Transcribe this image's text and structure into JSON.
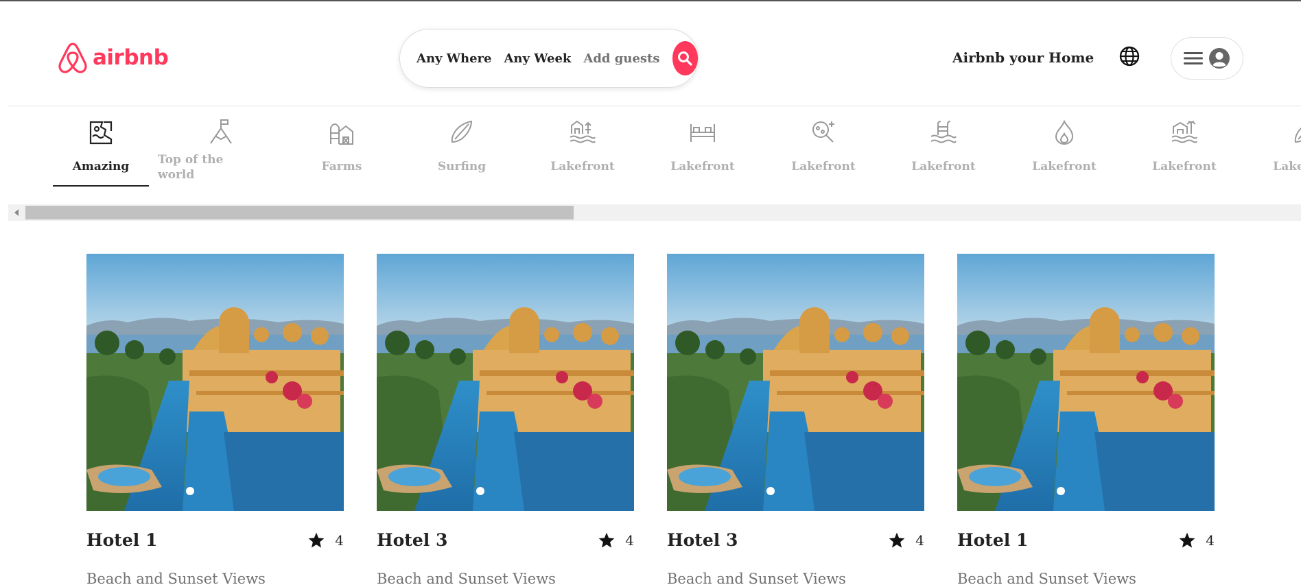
{
  "brand": {
    "name": "airbnb",
    "color": "#FF385C",
    "icon": "airbnb-logo-icon"
  },
  "search": {
    "where": "Any Where",
    "week": "Any Week",
    "guests": "Add guests",
    "icon": "search-icon"
  },
  "header": {
    "host_label": "Airbnb your Home",
    "globe_icon": "globe-icon",
    "menu_icon": "hamburger-icon",
    "avatar_icon": "user-avatar-icon"
  },
  "categories": [
    {
      "label": "Amazing",
      "icon": "amazing-pools-icon",
      "active": true
    },
    {
      "label": "Top of the world",
      "icon": "mountain-flag-icon",
      "active": false
    },
    {
      "label": "Farms",
      "icon": "farm-icon",
      "active": false
    },
    {
      "label": "Surfing",
      "icon": "surfboard-icon",
      "active": false
    },
    {
      "label": "Lakefront",
      "icon": "lakefront-house-icon",
      "active": false
    },
    {
      "label": "Lakefront",
      "icon": "beds-icon",
      "active": false
    },
    {
      "label": "Lakefront",
      "icon": "magnifier-sparkle-icon",
      "active": false
    },
    {
      "label": "Lakefront",
      "icon": "pool-ladder-icon",
      "active": false
    },
    {
      "label": "Lakefront",
      "icon": "flame-icon",
      "active": false
    },
    {
      "label": "Lakefront",
      "icon": "beach-house-icon",
      "active": false
    },
    {
      "label": "Lakefront",
      "icon": "surfboard-icon",
      "active": false
    }
  ],
  "scrollbar": {
    "position": 0.43
  },
  "listings": [
    {
      "title": "Hotel 1",
      "rating": "4",
      "subtitle": "Beach and Sunset Views"
    },
    {
      "title": "Hotel 3",
      "rating": "4",
      "subtitle": "Beach and Sunset Views"
    },
    {
      "title": "Hotel 3",
      "rating": "4",
      "subtitle": "Beach and Sunset Views"
    },
    {
      "title": "Hotel 1",
      "rating": "4",
      "subtitle": "Beach and Sunset Views"
    }
  ]
}
